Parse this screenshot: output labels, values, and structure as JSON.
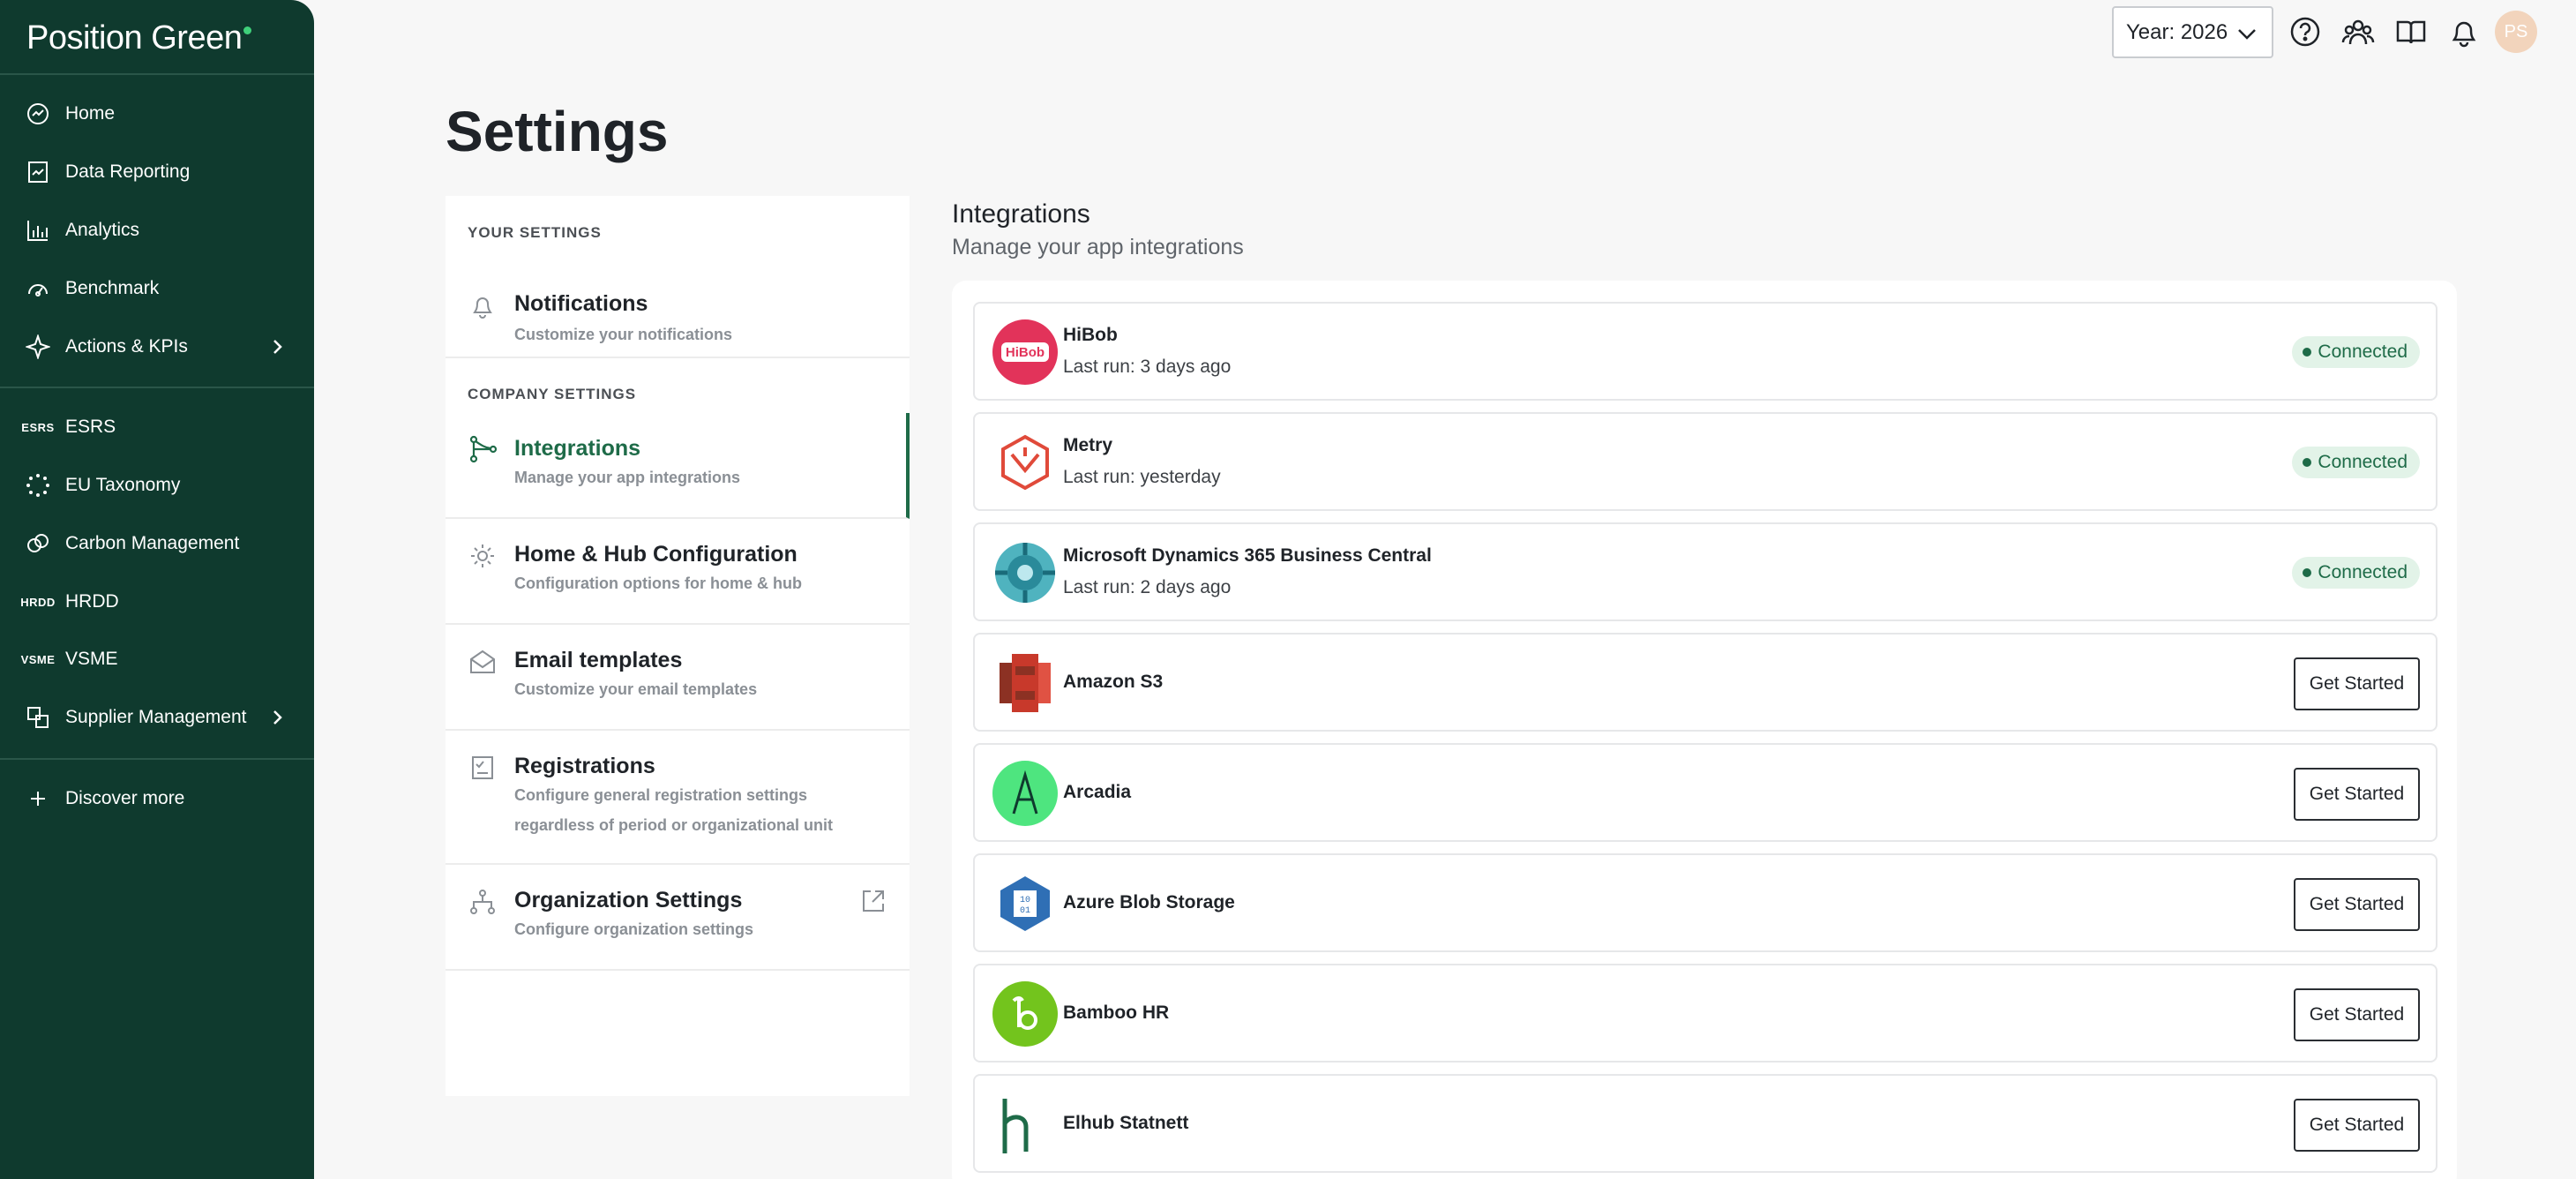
{
  "brand": {
    "name": "Position Green"
  },
  "sidebar": {
    "primary": [
      {
        "label": "Home",
        "icon": "home-icon"
      },
      {
        "label": "Data Reporting",
        "icon": "data-reporting-icon"
      },
      {
        "label": "Analytics",
        "icon": "analytics-icon"
      },
      {
        "label": "Benchmark",
        "icon": "benchmark-icon"
      },
      {
        "label": "Actions & KPIs",
        "icon": "actions-icon"
      }
    ],
    "modules": [
      {
        "label": "ESRS",
        "abbr": "ESRS"
      },
      {
        "label": "EU Taxonomy",
        "icon": "eu-taxonomy-icon"
      },
      {
        "label": "Carbon Management",
        "icon": "carbon-icon"
      },
      {
        "label": "HRDD",
        "abbr": "HRDD"
      },
      {
        "label": "VSME",
        "abbr": "VSME"
      },
      {
        "label": "Supplier Management",
        "icon": "supplier-icon"
      }
    ],
    "discover": "Discover more"
  },
  "topbar": {
    "year": "Year: 2026",
    "avatar": "PS"
  },
  "page": {
    "title": "Settings"
  },
  "settings": {
    "your_label": "YOUR SETTINGS",
    "company_label": "COMPANY SETTINGS",
    "notifications": {
      "title": "Notifications",
      "desc": "Customize your notifications"
    },
    "integrations": {
      "title": "Integrations",
      "desc": "Manage your app integrations"
    },
    "home_hub": {
      "title": "Home & Hub Configuration",
      "desc": "Configuration options for home & hub"
    },
    "email": {
      "title": "Email templates",
      "desc": "Customize your email templates"
    },
    "registrations": {
      "title": "Registrations",
      "desc": "Configure general registration settings regardless of period or organizational unit"
    },
    "organization": {
      "title": "Organization Settings",
      "desc": "Configure organization settings"
    }
  },
  "integrations": {
    "title": "Integrations",
    "subtitle": "Manage your app integrations",
    "connected_label": "Connected",
    "get_started_label": "Get Started",
    "items": [
      {
        "name": "HiBob",
        "last_run": "Last run: 3 days ago",
        "status": "connected"
      },
      {
        "name": "Metry",
        "last_run": "Last run: yesterday",
        "status": "connected"
      },
      {
        "name": "Microsoft Dynamics 365 Business Central",
        "last_run": "Last run: 2 days ago",
        "status": "connected"
      },
      {
        "name": "Amazon S3",
        "status": "available"
      },
      {
        "name": "Arcadia",
        "status": "available"
      },
      {
        "name": "Azure Blob Storage",
        "status": "available"
      },
      {
        "name": "Bamboo HR",
        "status": "available"
      },
      {
        "name": "Elhub Statnett",
        "status": "available"
      }
    ]
  },
  "colors": {
    "sidebar": "#0f3a2e",
    "accent": "#1e6b48",
    "badge_bg": "#e2f3e8"
  }
}
